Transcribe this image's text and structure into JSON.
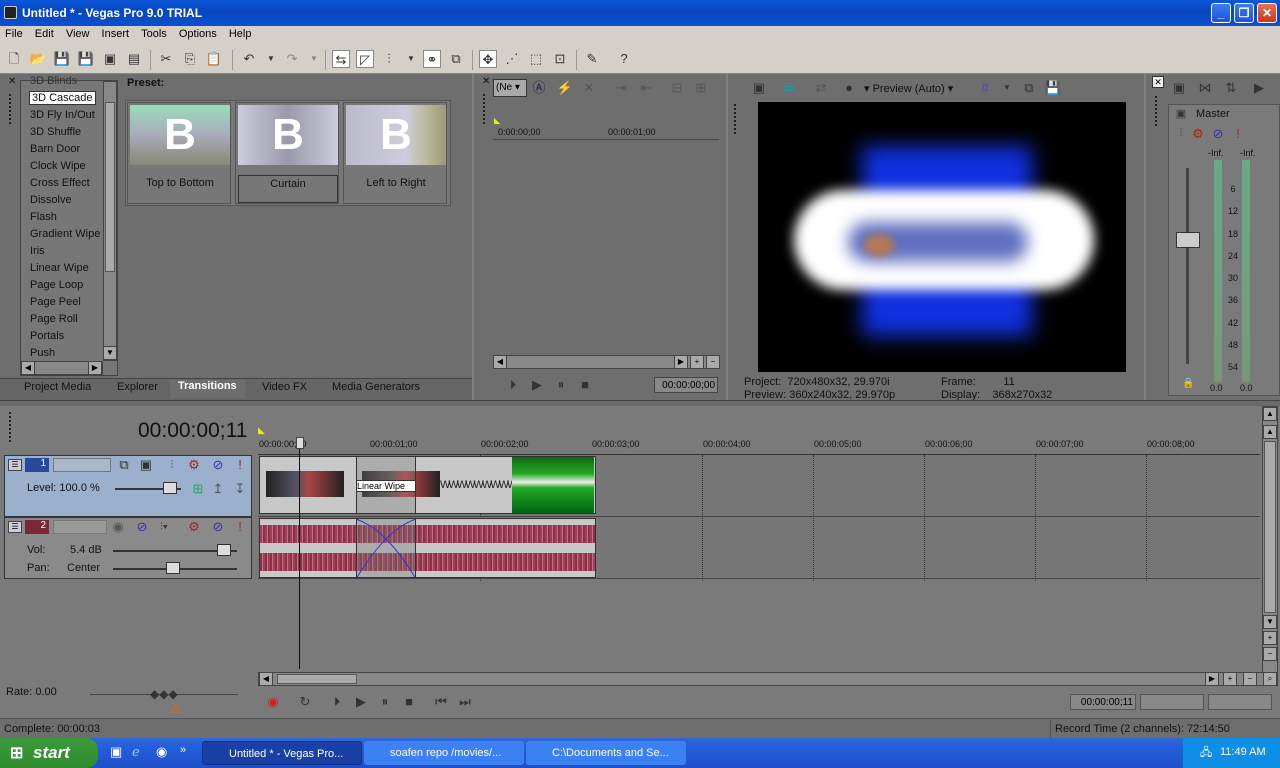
{
  "window": {
    "title": "Untitled * - Vegas Pro 9.0 TRIAL"
  },
  "menu": [
    "File",
    "Edit",
    "View",
    "Insert",
    "Tools",
    "Options",
    "Help"
  ],
  "transitions": {
    "items": [
      "3D Blinds",
      "3D Cascade",
      "3D Fly In/Out",
      "3D Shuffle",
      "Barn Door",
      "Clock Wipe",
      "Cross Effect",
      "Dissolve",
      "Flash",
      "Gradient Wipe",
      "Iris",
      "Linear Wipe",
      "Page Loop",
      "Page Peel",
      "Page Roll",
      "Portals",
      "Push"
    ],
    "selected": "3D Cascade",
    "preset_label": "Preset:",
    "presets": [
      "Top to Bottom",
      "Curtain",
      "Left to Right"
    ],
    "tabs": [
      "Project Media",
      "Explorer",
      "Transitions",
      "Video FX",
      "Media Generators"
    ]
  },
  "trimmer": {
    "dropdown": "(Ne",
    "ruler": [
      "0:00:00;00",
      "00:00:01;00"
    ],
    "time": "00:00:00;00"
  },
  "preview": {
    "mode": "Preview (Auto)",
    "project_label": "Project:",
    "project_value": "720x480x32, 29.970i",
    "preview_label": "Preview:",
    "preview_value": "360x240x32, 29.970p",
    "frame_label": "Frame:",
    "frame_value": "11",
    "display_label": "Display:",
    "display_value": "368x270x32"
  },
  "mixer": {
    "label": "Master",
    "left": "-Inf.",
    "right": "-Inf.",
    "scale": [
      "6",
      "12",
      "18",
      "24",
      "30",
      "36",
      "42",
      "48",
      "54"
    ],
    "bottom_left": "0.0",
    "bottom_right": "0.0"
  },
  "timeline": {
    "cursor_time": "00:00:00;11",
    "ruler": [
      "00:00:00;00",
      "00:00:01;00",
      "00:00:02;00",
      "00:00:03;00",
      "00:00:04;00",
      "00:00:05;00",
      "00:00:06;00",
      "00:00:07;00",
      "00:00:08;00"
    ],
    "track1": {
      "number": "1",
      "level_label": "Level: 100.0 %"
    },
    "track2": {
      "number": "2",
      "vol_label": "Vol:",
      "vol_value": "5.4 dB",
      "pan_label": "Pan:",
      "pan_value": "Center"
    },
    "transition_label": "Linear Wipe",
    "rate": "Rate: 0.00",
    "time_display": "00:00:00;11"
  },
  "status": {
    "left": "Complete: 00:00:03",
    "right": "Record Time (2 channels): 72:14:50"
  },
  "taskbar": {
    "start": "start",
    "tasks": [
      "Untitled * - Vegas Pro...",
      "soafen repo /movies/...",
      "C:\\Documents and Se..."
    ],
    "clock": "11:49 AM"
  },
  "colors": {
    "titlebar": "#0a4fd0",
    "panel": "#6e6e6e",
    "video_track": "#9ab0cc",
    "audio_wave": "#a0405a",
    "audio_track": "#7a2838"
  }
}
